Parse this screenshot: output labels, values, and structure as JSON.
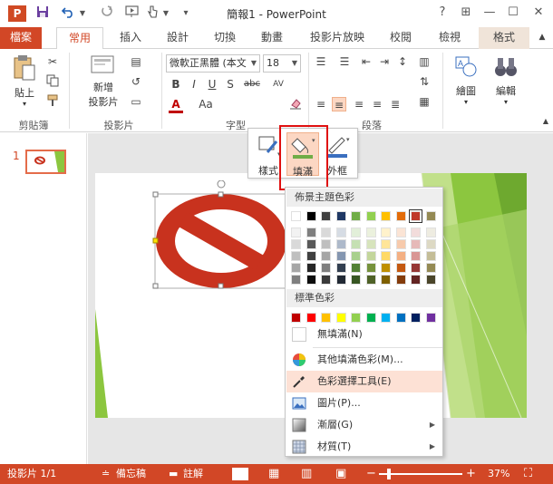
{
  "app": {
    "title": "簡報1 - PowerPoint",
    "logo_letter": "P"
  },
  "qat": {
    "save_icon": "save-icon",
    "undo_icon": "undo-icon",
    "redo_icon": "redo-icon"
  },
  "window": {
    "help": "?",
    "restore_ribbon": "⊞",
    "minimize": "—",
    "maximize": "☐",
    "close": "✕"
  },
  "tabs": {
    "file": "檔案",
    "home": "常用",
    "insert": "插入",
    "design": "設計",
    "transitions": "切換",
    "animations": "動畫",
    "slideshow": "投影片放映",
    "review": "校閱",
    "view": "檢視",
    "format": "格式"
  },
  "ribbon": {
    "paste": "貼上",
    "clipboard": "剪貼簿",
    "new_slide_line1": "新增",
    "new_slide_line2": "投影片",
    "slides": "投影片",
    "font_name": "微軟正黑體 (本文",
    "font_size": "18",
    "font": "字型",
    "paragraph": "段落",
    "drawing": "繪圖",
    "editing": "編輯",
    "bold": "B",
    "italic": "I",
    "underline": "U",
    "shadow": "S",
    "strike": "abc",
    "spacing": "AV",
    "font_color": "A",
    "font_case": "Aa"
  },
  "mini_toolbar": {
    "style": "樣式",
    "fill": "填滿",
    "outline": "外框"
  },
  "thumbs": {
    "slide_number": "1"
  },
  "panel": {
    "theme_colors": "佈景主題色彩",
    "standard_colors": "標準色彩",
    "no_fill": "無填滿(N)",
    "more_colors": "其他填滿色彩(M)...",
    "eyedropper": "色彩選擇工具(E)",
    "picture": "圖片(P)...",
    "gradient": "漸層(G)",
    "texture": "材質(T)",
    "theme_top_row": [
      "#ffffff",
      "#000000",
      "#404040",
      "#1f3864",
      "#70ad47",
      "#92d050",
      "#ffc000",
      "#e36c09",
      "#c0392b",
      "#948a54"
    ],
    "theme_shades": [
      [
        "#f2f2f2",
        "#7f7f7f",
        "#d9d9d9",
        "#d6dce4",
        "#e2efd9",
        "#ebf1dd",
        "#fff2cc",
        "#fbe4d5",
        "#f2dcdb",
        "#eeece1"
      ],
      [
        "#d9d9d9",
        "#595959",
        "#bfbfbf",
        "#adb9ca",
        "#c5e0b3",
        "#d7e4bc",
        "#ffe599",
        "#f7caac",
        "#e6b9b8",
        "#ddd9c4"
      ],
      [
        "#bfbfbf",
        "#404040",
        "#a6a6a6",
        "#8496b0",
        "#a8d08d",
        "#c3d69b",
        "#ffd966",
        "#f4b083",
        "#d99694",
        "#c4bd97"
      ],
      [
        "#a6a6a6",
        "#262626",
        "#7f7f7f",
        "#333f50",
        "#538135",
        "#76923c",
        "#bf8f00",
        "#c45911",
        "#953735",
        "#948a54"
      ],
      [
        "#7f7f7f",
        "#0d0d0d",
        "#3a3a3a",
        "#222a35",
        "#375623",
        "#4f6228",
        "#7f6000",
        "#843c0c",
        "#632423",
        "#4a452a"
      ]
    ],
    "standard_row": [
      "#c00000",
      "#ff0000",
      "#ffc000",
      "#ffff00",
      "#92d050",
      "#00b050",
      "#00b0f0",
      "#0070c0",
      "#002060",
      "#7030a0"
    ]
  },
  "status": {
    "slide_info": "投影片 1/1",
    "notes": "備忘稿",
    "comments": "註解",
    "zoom": "37%"
  },
  "colors": {
    "accent": "#d24726",
    "highlight_red": "#e01010",
    "no_symbol_red": "#c8321e",
    "slide_green": "#8cc63f"
  }
}
